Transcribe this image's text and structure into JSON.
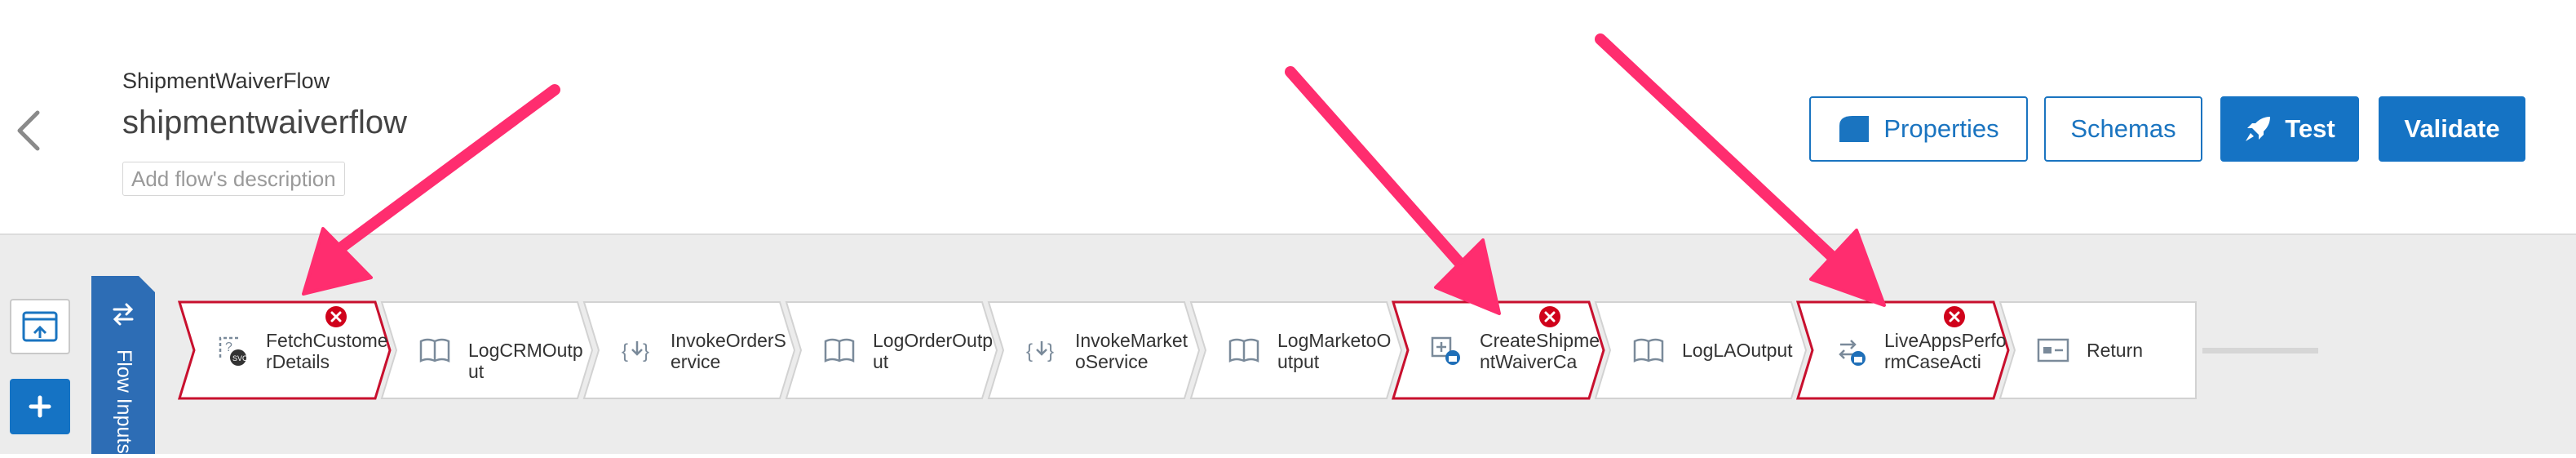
{
  "header": {
    "flow_name": "ShipmentWaiverFlow",
    "flow_title": "shipmentwaiverflow",
    "description_placeholder": "Add flow's description",
    "buttons": {
      "properties": "Properties",
      "schemas": "Schemas",
      "test": "Test",
      "validate": "Validate"
    }
  },
  "canvas": {
    "flow_inputs_label": "Flow Inputs",
    "tiles": [
      {
        "label": "FetchCustomerDetails",
        "icon": "rest-invoke-icon",
        "error": true
      },
      {
        "label": "LogCRMOutput",
        "icon": "log-book-icon",
        "error": false
      },
      {
        "label": "InvokeOrderService",
        "icon": "invoke-service-icon",
        "error": false
      },
      {
        "label": "LogOrderOutput",
        "icon": "log-book-icon",
        "error": false
      },
      {
        "label": "InvokeMarketoService",
        "icon": "invoke-service-icon",
        "error": false
      },
      {
        "label": "LogMarketoOutput",
        "icon": "log-book-icon",
        "error": false
      },
      {
        "label": "CreateShipmentWaiverCa",
        "icon": "create-case-icon",
        "error": true
      },
      {
        "label": "LogLAOutput",
        "icon": "log-book-icon",
        "error": false
      },
      {
        "label": "LiveAppsPerformCaseActi",
        "icon": "perform-case-action-icon",
        "error": true
      },
      {
        "label": "Return",
        "icon": "return-icon",
        "error": false
      }
    ]
  },
  "colors": {
    "primary": "#1573c4",
    "error_border": "#c8102e",
    "error_badge": "#d0021b",
    "annotation_arrow": "#ff2d6f",
    "canvas_bg": "#ececec",
    "flow_inputs_bg": "#2d6db5"
  },
  "annotations": {
    "arrow_count": 3
  }
}
